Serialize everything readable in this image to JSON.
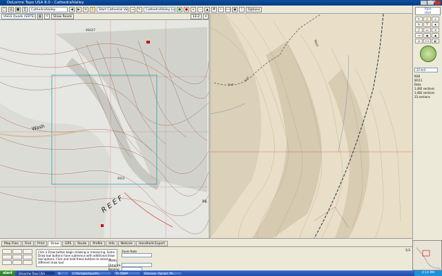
{
  "window": {
    "title": "DeLorme Topo USA 8.0 - CathedralValley"
  },
  "toolbar": {
    "map_name_select": "CathedralValley",
    "route_select": "Start Cathedral Valley",
    "route_select_2": "CathedralValley Loop Ed 2",
    "options_label": "Options"
  },
  "left_map": {
    "data_select": "USGS Quads (SDTS)",
    "show_roads_label": "Show Roads",
    "zoom_label": "13-2",
    "label_wash": "Wash",
    "label_reef": "R E E F",
    "label_elev_1": "4642/7",
    "label_elev_2": "4653",
    "label_mi": "Mi"
  },
  "right_map": {
    "label_trail_1": "Trail",
    "label_trail_2": "Trail",
    "label_wash": "Wash"
  },
  "sidebar": {
    "logo_line1": "Topo",
    "logo_line2": "USA",
    "help_label": "HELP",
    "zoom_select": "37-0.0",
    "coord_line1": "N38",
    "coord_line2": "W111",
    "info_line1": "Data",
    "info_line2": "1,492 sections",
    "info_line3": "1,482 sections",
    "info_line4": "33 sections"
  },
  "bottom": {
    "tabs": [
      "Map Files",
      "Find",
      "Print",
      "Draw",
      "GPS",
      "Route",
      "Profile",
      "Info",
      "NetLink",
      "Handheld Export"
    ],
    "active_tab": "Draw",
    "help_text": "Click a Draw button begin drawing or measuring. Some Draw tool buttons have submenus with additional draw tool options. Click and hold these buttons to select a different draw tool.",
    "zoom_rate_label": "Zoom Rate",
    "width_label": "Width",
    "distance_label": "Distance",
    "bearing_label": "Bearing",
    "page_label": "1/3"
  },
  "taskbar": {
    "start_label": "start",
    "tasks": [
      "DeLorme Topo USA",
      "E",
      "C:\\PortableApps\\Po...",
      "Trs 5BMP",
      "Ehlmann, Ronald, Ph..."
    ],
    "clock": "4:14 PM"
  }
}
